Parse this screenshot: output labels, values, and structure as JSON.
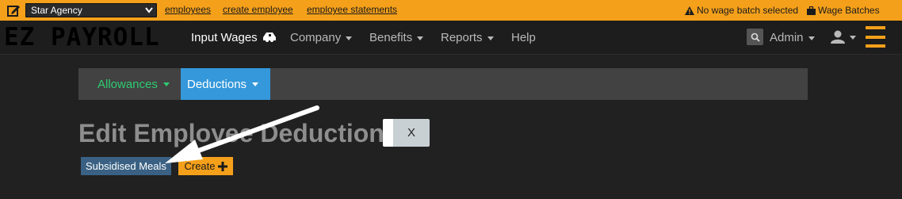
{
  "topbar": {
    "agency_selected": "Star Agency",
    "links": [
      "employees",
      "create employee",
      "employee statements"
    ],
    "wage_batch_status": "No wage batch selected",
    "wage_batches_label": "Wage Batches",
    "accent_color": "#f5a01a"
  },
  "navbar": {
    "brand": "EZ PAYROLL",
    "input_wages": "Input Wages",
    "company": "Company",
    "benefits": "Benefits",
    "reports": "Reports",
    "help": "Help",
    "admin": "Admin"
  },
  "subnav": {
    "allowances": "Allowances",
    "deductions": "Deductions"
  },
  "page": {
    "title": "Edit Employee Deductions",
    "close_label": "X",
    "deduction_item": "Subsidised Meals",
    "create_label": "Create"
  },
  "icons": [
    "edit-icon",
    "chevron-down-icon",
    "warning-icon",
    "briefcase-icon",
    "truck-icon",
    "search-icon",
    "user-icon",
    "hamburger-icon",
    "plus-icon"
  ],
  "colors": {
    "navbar_bg": "#1d1d1d",
    "body_bg": "#212121",
    "subnav_bg": "#424242",
    "deductions_active": "#3498db",
    "allowances_text": "#2ecc71",
    "deduction_item_bg": "#3a6183"
  }
}
